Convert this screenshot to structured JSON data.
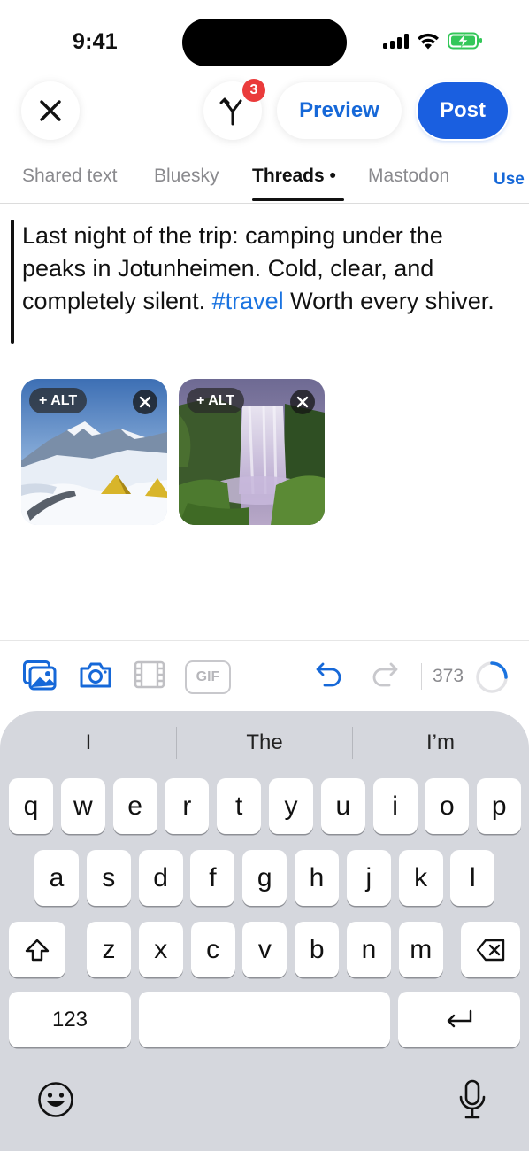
{
  "status_bar": {
    "time": "9:41"
  },
  "header": {
    "close_icon": "close-icon",
    "fork_badge_count": "3",
    "preview_label": "Preview",
    "post_label": "Post"
  },
  "tabs": {
    "items": [
      {
        "label": "Shared text"
      },
      {
        "label": "Bluesky"
      },
      {
        "label": "Threads •"
      },
      {
        "label": "Mastodon"
      }
    ],
    "overflow_label": "Use",
    "active_index": 2
  },
  "composer": {
    "text_before_hashtag": "Last night of the trip: camping under the peaks in Jotunheimen. Cold, clear, and completely silent. ",
    "hashtag": "#travel",
    "text_after_hashtag": " Worth every shiver.",
    "media": [
      {
        "alt_label": "+ ALT",
        "subject": "snowy mountains with yellow tents"
      },
      {
        "alt_label": "+ ALT",
        "subject": "waterfall with green cliffs"
      }
    ]
  },
  "toolbar": {
    "gif_label": "GIF",
    "char_count": "373",
    "progress_fraction": 0.25
  },
  "keyboard": {
    "suggestions": [
      "I",
      "The",
      "I’m"
    ],
    "row1": [
      "q",
      "w",
      "e",
      "r",
      "t",
      "y",
      "u",
      "i",
      "o",
      "p"
    ],
    "row2": [
      "a",
      "s",
      "d",
      "f",
      "g",
      "h",
      "j",
      "k",
      "l"
    ],
    "row3": [
      "z",
      "x",
      "c",
      "v",
      "b",
      "n",
      "m"
    ],
    "numbers_label": "123"
  },
  "colors": {
    "accent": "#1a5fe0",
    "link": "#1668d8",
    "badge": "#ea3b3b",
    "keyboard_bg": "#d5d7dd"
  }
}
